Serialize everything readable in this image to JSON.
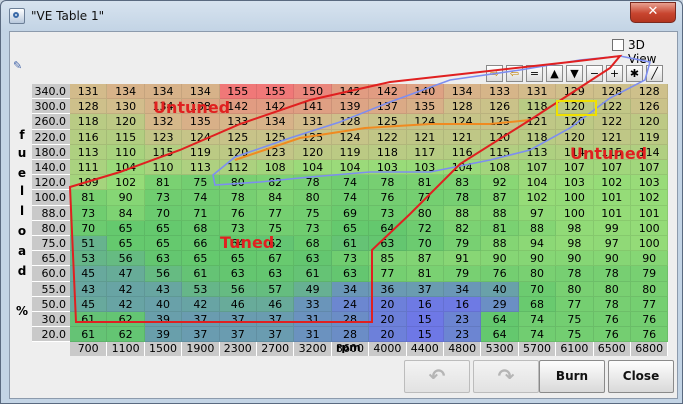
{
  "window": {
    "title": "\"VE Table 1\"",
    "close_label": "✕"
  },
  "view3d": {
    "label": "3D View",
    "checked": false
  },
  "y_axis_title": [
    "f",
    "u",
    "e",
    "l",
    "l",
    "o",
    "a",
    "d",
    "",
    "%"
  ],
  "x_axis_title": "rpm",
  "toolbar": [
    "⇨",
    "⇦",
    "=",
    "▲",
    "▼",
    "−",
    "+",
    "✱",
    "╱"
  ],
  "load_values": [
    "340.0",
    "300.0",
    "260.0",
    "220.0",
    "180.0",
    "140.0",
    "120.0",
    "100.0",
    "88.0",
    "80.0",
    "75.0",
    "65.0",
    "60.0",
    "55.0",
    "50.0",
    "30.0",
    "20.0"
  ],
  "rpm_values": [
    "700",
    "1100",
    "1500",
    "1900",
    "2300",
    "2700",
    "3200",
    "3600",
    "4000",
    "4400",
    "4800",
    "5300",
    "5700",
    "6100",
    "6500",
    "6800"
  ],
  "table": [
    [
      131,
      134,
      134,
      134,
      155,
      155,
      150,
      142,
      142,
      140,
      134,
      133,
      131,
      129,
      128,
      128
    ],
    [
      128,
      130,
      134,
      138,
      142,
      142,
      141,
      139,
      137,
      135,
      128,
      126,
      118,
      120,
      122,
      126
    ],
    [
      118,
      120,
      132,
      135,
      133,
      134,
      131,
      128,
      125,
      124,
      124,
      125,
      121,
      120,
      122,
      120
    ],
    [
      116,
      115,
      123,
      124,
      125,
      125,
      125,
      124,
      122,
      121,
      121,
      120,
      118,
      120,
      121,
      119
    ],
    [
      113,
      110,
      115,
      119,
      120,
      123,
      120,
      119,
      118,
      117,
      116,
      115,
      113,
      114,
      115,
      114
    ],
    [
      111,
      104,
      110,
      113,
      112,
      108,
      104,
      104,
      103,
      103,
      104,
      108,
      107,
      107,
      107,
      107
    ],
    [
      109,
      102,
      81,
      75,
      80,
      82,
      78,
      74,
      78,
      81,
      83,
      92,
      104,
      103,
      102,
      103
    ],
    [
      81,
      90,
      73,
      74,
      78,
      84,
      80,
      74,
      76,
      77,
      78,
      87,
      102,
      100,
      101,
      102
    ],
    [
      73,
      84,
      70,
      71,
      76,
      77,
      75,
      69,
      73,
      80,
      88,
      88,
      97,
      100,
      101,
      101
    ],
    [
      70,
      65,
      65,
      68,
      73,
      75,
      73,
      65,
      64,
      72,
      82,
      81,
      88,
      98,
      99,
      100
    ],
    [
      51,
      65,
      65,
      66,
      64,
      62,
      68,
      61,
      63,
      70,
      79,
      88,
      94,
      98,
      97,
      100
    ],
    [
      53,
      56,
      63,
      65,
      65,
      67,
      63,
      73,
      85,
      87,
      91,
      90,
      90,
      90,
      90,
      90
    ],
    [
      45,
      47,
      56,
      61,
      63,
      63,
      61,
      63,
      77,
      81,
      79,
      76,
      80,
      78,
      78,
      79
    ],
    [
      43,
      42,
      43,
      53,
      56,
      57,
      49,
      34,
      36,
      37,
      34,
      40,
      70,
      80,
      80,
      80
    ],
    [
      45,
      42,
      40,
      42,
      46,
      46,
      33,
      24,
      20,
      16,
      16,
      29,
      68,
      77,
      78,
      77
    ],
    [
      61,
      62,
      39,
      37,
      37,
      37,
      31,
      28,
      20,
      15,
      23,
      64,
      74,
      75,
      76,
      76
    ],
    [
      61,
      62,
      39,
      37,
      37,
      37,
      31,
      28,
      20,
      15,
      23,
      64,
      74,
      75,
      76,
      76
    ]
  ],
  "annotations": {
    "untuned_left": "Untuned",
    "untuned_right": "Untuned",
    "tuned": "Tuned"
  },
  "buttons": {
    "undo": "↶",
    "redo": "↷",
    "burn": "Burn",
    "close": "Close"
  }
}
